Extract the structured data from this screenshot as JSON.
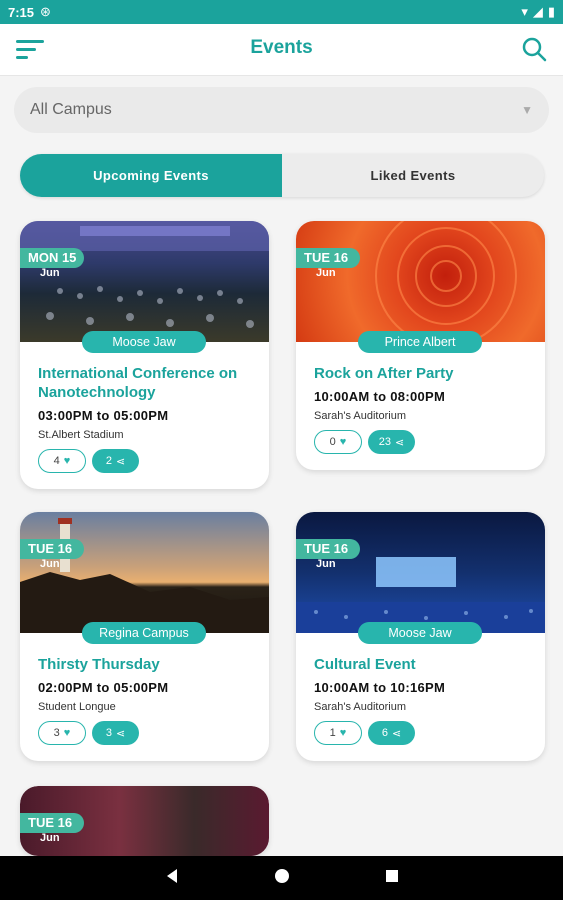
{
  "status": {
    "time": "7:15"
  },
  "header": {
    "title": "Events",
    "menu_icon": "hamburger-icon",
    "search_icon": "search-icon"
  },
  "filter": {
    "selected": "All Campus"
  },
  "tabs": [
    {
      "label": "Upcoming Events",
      "active": true
    },
    {
      "label": "Liked Events",
      "active": false
    }
  ],
  "events": [
    {
      "day": "MON 15",
      "month": "Jun",
      "campus": "Moose Jaw",
      "name": "International Conference on Nanotechnology",
      "time": "03:00PM to 05:00PM",
      "venue": "St.Albert Stadium",
      "likes": "4",
      "shares": "2"
    },
    {
      "day": "TUE 16",
      "month": "Jun",
      "campus": "Prince Albert",
      "name": "Rock on After Party",
      "time": "10:00AM to 08:00PM",
      "venue": "Sarah's Auditorium",
      "likes": "0",
      "shares": "23"
    },
    {
      "day": "TUE 16",
      "month": "Jun",
      "campus": "Regina Campus",
      "name": "Thirsty Thursday",
      "time": "02:00PM to 05:00PM",
      "venue": "Student Longue",
      "likes": "3",
      "shares": "3"
    },
    {
      "day": "TUE 16",
      "month": "Jun",
      "campus": "Moose Jaw",
      "name": "Cultural Event",
      "time": "10:00AM to 10:16PM",
      "venue": "Sarah's Auditorium",
      "likes": "1",
      "shares": "6"
    },
    {
      "day": "TUE 16",
      "month": "Jun"
    }
  ],
  "colors": {
    "accent": "#1ba39c",
    "pill": "#28b5ad",
    "date_badge": "#43b79f"
  }
}
